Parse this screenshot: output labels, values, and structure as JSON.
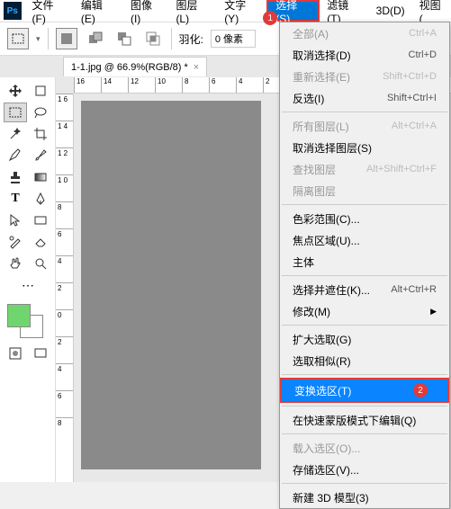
{
  "app": {
    "logo": "Ps"
  },
  "menubar": [
    {
      "label": "文件(F)"
    },
    {
      "label": "编辑(E)"
    },
    {
      "label": "图像(I)"
    },
    {
      "label": "图层(L)"
    },
    {
      "label": "文字(Y)"
    },
    {
      "label": "选择(S)",
      "active": true
    },
    {
      "label": "滤镜(T)"
    },
    {
      "label": "3D(D)"
    },
    {
      "label": "视图("
    }
  ],
  "marker": {
    "one": "1",
    "two": "2"
  },
  "options": {
    "feather_label": "羽化:",
    "feather_value": "0 像素"
  },
  "tab": {
    "title": "1-1.jpg @ 66.9%(RGB/8) *",
    "close": "×"
  },
  "ruler_h": [
    "16",
    "14",
    "12",
    "10",
    "8",
    "6",
    "4",
    "2"
  ],
  "ruler_v": [
    "1 6",
    "1 4",
    "1 2",
    "1 0",
    "8",
    "6",
    "4",
    "2",
    "0",
    "2",
    "4",
    "6",
    "8"
  ],
  "dropdown": [
    {
      "label": "全部(A)",
      "shortcut": "Ctrl+A",
      "disabled": true
    },
    {
      "label": "取消选择(D)",
      "shortcut": "Ctrl+D"
    },
    {
      "label": "重新选择(E)",
      "shortcut": "Shift+Ctrl+D",
      "disabled": true
    },
    {
      "label": "反选(I)",
      "shortcut": "Shift+Ctrl+I"
    },
    {
      "sep": true
    },
    {
      "label": "所有图层(L)",
      "shortcut": "Alt+Ctrl+A",
      "disabled": true
    },
    {
      "label": "取消选择图层(S)"
    },
    {
      "label": "查找图层",
      "shortcut": "Alt+Shift+Ctrl+F",
      "disabled": true
    },
    {
      "label": "隔离图层",
      "disabled": true
    },
    {
      "sep": true
    },
    {
      "label": "色彩范围(C)..."
    },
    {
      "label": "焦点区域(U)..."
    },
    {
      "label": "主体"
    },
    {
      "sep": true
    },
    {
      "label": "选择并遮住(K)...",
      "shortcut": "Alt+Ctrl+R"
    },
    {
      "label": "修改(M)",
      "arrow": true
    },
    {
      "sep": true
    },
    {
      "label": "扩大选取(G)"
    },
    {
      "label": "选取相似(R)"
    },
    {
      "sep": true
    },
    {
      "label": "变换选区(T)",
      "highlight": true
    },
    {
      "sep": true
    },
    {
      "label": "在快速蒙版模式下编辑(Q)"
    },
    {
      "sep": true
    },
    {
      "label": "载入选区(O)...",
      "disabled": true
    },
    {
      "label": "存储选区(V)..."
    },
    {
      "sep": true
    },
    {
      "label": "新建 3D 模型(3)"
    }
  ]
}
